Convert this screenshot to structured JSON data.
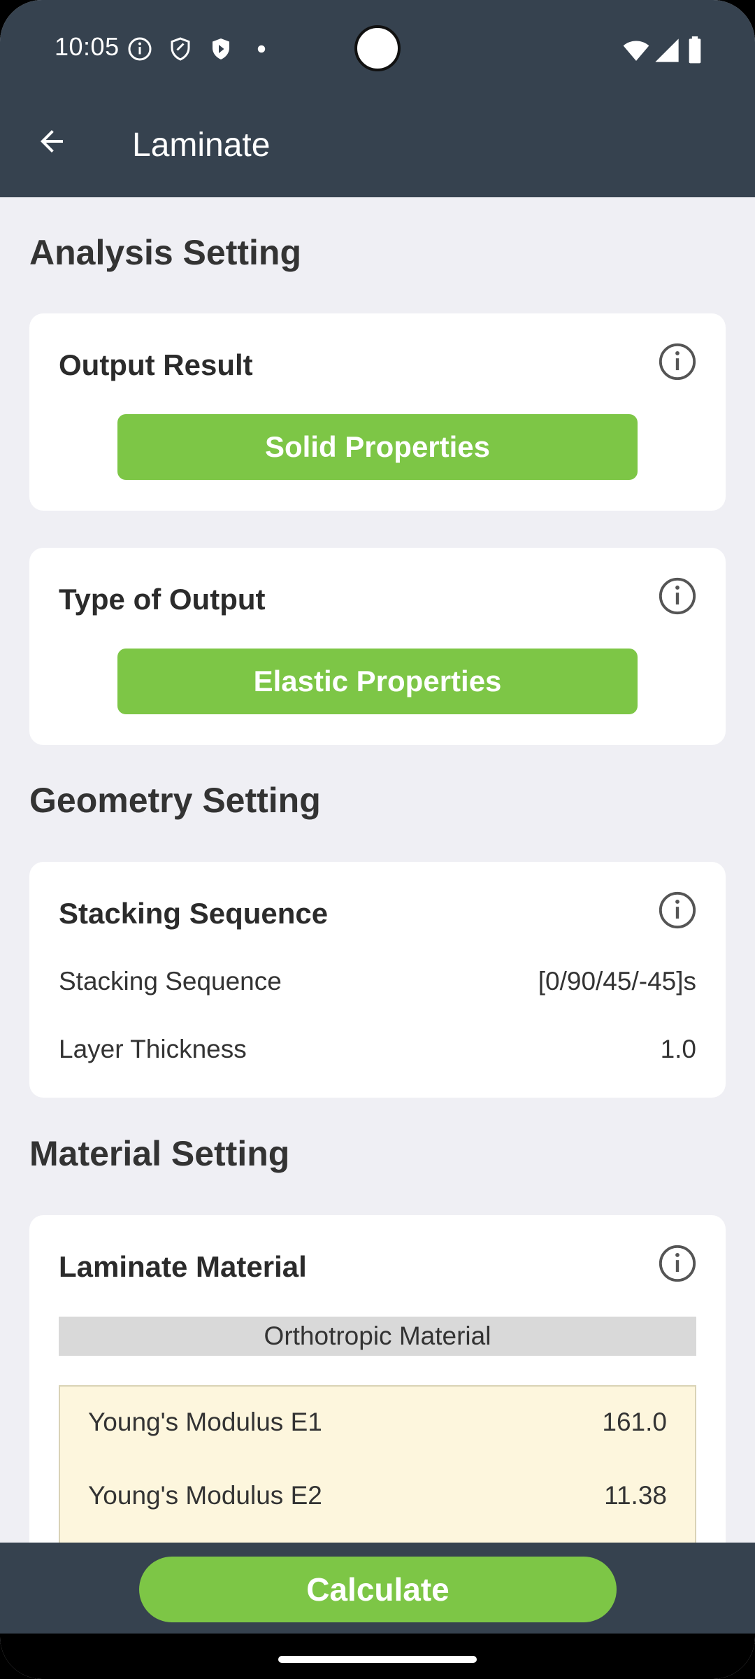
{
  "status_bar": {
    "time": "10:05"
  },
  "app_bar": {
    "title": "Laminate"
  },
  "analysis_setting": {
    "heading": "Analysis Setting",
    "output_result": {
      "title": "Output Result",
      "button": "Solid Properties"
    },
    "type_of_output": {
      "title": "Type of Output",
      "button": "Elastic Properties"
    }
  },
  "geometry_setting": {
    "heading": "Geometry Setting",
    "card_title": "Stacking Sequence",
    "rows": [
      {
        "label": "Stacking Sequence",
        "value": "[0/90/45/-45]s"
      },
      {
        "label": "Layer Thickness",
        "value": "1.0"
      }
    ]
  },
  "material_setting": {
    "heading": "Material Setting",
    "card_title": "Laminate Material",
    "material_type": "Orthotropic Material",
    "properties": [
      {
        "label": "Young's Modulus E1",
        "value": "161.0"
      },
      {
        "label": "Young's Modulus E2",
        "value": "11.38"
      }
    ]
  },
  "bottom": {
    "calculate_label": "Calculate"
  },
  "colors": {
    "header": "#36424f",
    "accent_green": "#7dc646",
    "background": "#efeff4",
    "property_box": "#fdf6dd"
  }
}
